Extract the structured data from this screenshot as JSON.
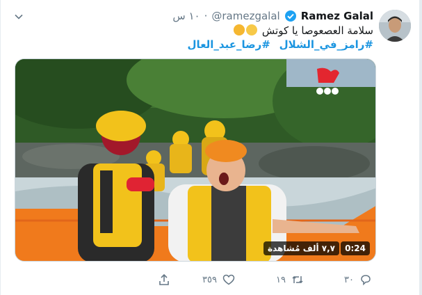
{
  "tweet": {
    "display_name": "Ramez Galal",
    "handle": "@ramezgalal",
    "separator": "·",
    "time": "١٠ س",
    "text": "سلامة العصعوصا يا كوتش",
    "hashtags": [
      "#رامز_في_الشلال",
      "#رضا_عبد_العال"
    ]
  },
  "media": {
    "duration": "0:24",
    "views": "٧,٧ ألف مُشاهدة",
    "channel_logo": "mbc-masr-logo"
  },
  "actions": {
    "reply_count": "٣٠",
    "retweet_count": "١٩",
    "like_count": "٣٥٩"
  },
  "colors": {
    "accent": "#1b95e0",
    "verified": "#1da1f2",
    "muted": "#657786"
  },
  "icons": [
    "chevron-down-icon",
    "verified-badge-icon",
    "reply-icon",
    "retweet-icon",
    "like-icon",
    "share-icon"
  ]
}
